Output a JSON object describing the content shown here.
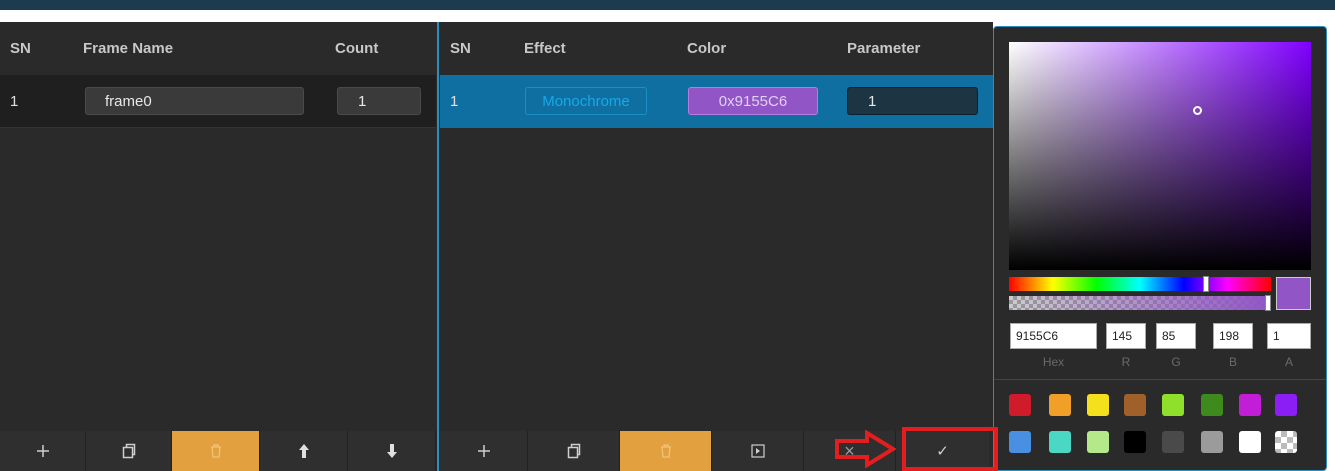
{
  "frames": {
    "headers": {
      "sn": "SN",
      "name": "Frame Name",
      "count": "Count"
    },
    "rows": [
      {
        "sn": "1",
        "name": "frame0",
        "count": "1"
      }
    ],
    "toolbar": [
      "plus-icon",
      "copy-icon",
      "delete-icon",
      "move-up-icon",
      "move-down-icon"
    ]
  },
  "effects": {
    "headers": {
      "sn": "SN",
      "effect": "Effect",
      "color": "Color",
      "parameter": "Parameter"
    },
    "rows": [
      {
        "sn": "1",
        "effect": "Monochrome",
        "color": "0x9155C6",
        "parameter": "1"
      }
    ],
    "toolbar": [
      "plus-icon",
      "copy-icon",
      "delete-icon",
      "preview-icon",
      "close-icon",
      "check-icon"
    ],
    "close_label": "×",
    "confirm_label": "✓"
  },
  "picker": {
    "hex": "9155C6",
    "r": "145",
    "g": "85",
    "b": "198",
    "a": "1",
    "labels": {
      "hex": "Hex",
      "r": "R",
      "g": "G",
      "b": "B",
      "a": "A"
    },
    "current_color": "#9155C6",
    "swatches": [
      "#d01b2b",
      "#f0a028",
      "#f5e01e",
      "#a0602a",
      "#8ee02a",
      "#3f8a1c",
      "#c21ed8",
      "#8a1ef5",
      "#4a90e2",
      "#4ad8c4",
      "#b4e888",
      "#000000",
      "#4a4a4a",
      "#9b9b9b",
      "#ffffff",
      "checker"
    ]
  },
  "colors": {
    "accent": "#2a8fbf",
    "selected_row": "#0f6fa0",
    "orange": "#e3a03e",
    "annotation": "#e41e1e"
  }
}
